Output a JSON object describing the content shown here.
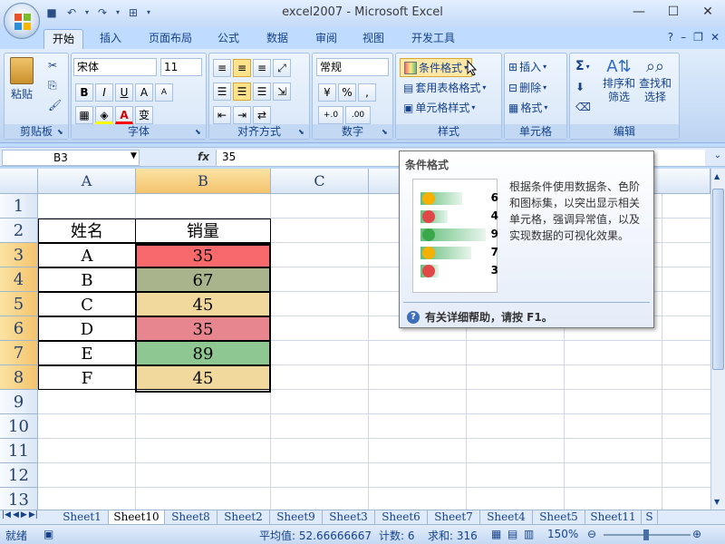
{
  "window": {
    "title": "excel2007 - Microsoft Excel"
  },
  "tabs": [
    "开始",
    "插入",
    "页面布局",
    "公式",
    "数据",
    "审阅",
    "视图",
    "开发工具"
  ],
  "ribbon": {
    "clipboard": {
      "label": "剪贴板",
      "paste": "粘贴"
    },
    "font": {
      "label": "字体",
      "name": "宋体",
      "size": "11",
      "bold": "B",
      "italic": "I",
      "underline": "U",
      "grow": "A",
      "wen": "变"
    },
    "alignment": {
      "label": "对齐方式"
    },
    "number": {
      "label": "数字",
      "format": "常规",
      "percent": "%",
      "comma": ",",
      "inc_decimal": "+.0",
      "dec_decimal": ".00"
    },
    "styles": {
      "label": "样式",
      "conditional": "条件格式",
      "table": "套用表格格式",
      "cell": "单元格样式"
    },
    "cells": {
      "label": "单元格",
      "insert": "插入",
      "delete": "删除",
      "format": "格式"
    },
    "editing": {
      "label": "编辑",
      "sigma": "Σ",
      "sort": "排序和",
      "filter": "筛选",
      "find": "查找和",
      "select": "选择"
    }
  },
  "formula_bar": {
    "name_box": "B3",
    "fx": "fx",
    "content": "35"
  },
  "columns": [
    "A",
    "B",
    "C"
  ],
  "rows": [
    "1",
    "2",
    "3",
    "4",
    "5",
    "6",
    "7",
    "8",
    "9",
    "10",
    "11",
    "12",
    "13"
  ],
  "table": {
    "header": [
      "姓名",
      "销量"
    ],
    "rows": [
      {
        "name": "A",
        "value": "35",
        "color": "#f8696b",
        "arrow": "down"
      },
      {
        "name": "B",
        "value": "67",
        "color": "#a9b48c",
        "arrow": "right"
      },
      {
        "name": "C",
        "value": "45",
        "color": "#f1d89c",
        "arrow": "down"
      },
      {
        "name": "D",
        "value": "35",
        "color": "#e8868f",
        "arrow": "down"
      },
      {
        "name": "E",
        "value": "89",
        "color": "#8fc792",
        "arrow": "up"
      },
      {
        "name": "F",
        "value": "45",
        "color": "#f1d89c",
        "arrow": "down"
      }
    ]
  },
  "tooltip": {
    "title": "条件格式",
    "description": "根据条件使用数据条、色阶和图标集，以突出显示相关单元格，强调异常值，以及实现数据的可视化效果。",
    "sample": [
      {
        "num": "6",
        "icon": "yellow"
      },
      {
        "num": "4",
        "icon": "red"
      },
      {
        "num": "9",
        "icon": "green"
      },
      {
        "num": "7",
        "icon": "yellow"
      },
      {
        "num": "3",
        "icon": "red"
      }
    ],
    "help": "有关详细帮助，请按 F1。"
  },
  "sheets": [
    "Sheet1",
    "Sheet10",
    "Sheet8",
    "Sheet2",
    "Sheet9",
    "Sheet3",
    "Sheet6",
    "Sheet7",
    "Sheet4",
    "Sheet5",
    "Sheet11",
    "S"
  ],
  "active_sheet": "Sheet10",
  "status": {
    "mode": "就绪",
    "average": "平均值: 52.66666667",
    "count": "计数: 6",
    "sum": "求和: 316",
    "zoom": "150%"
  },
  "colors": {
    "accent": "#15428b",
    "selected_header": "#f4c36c"
  }
}
